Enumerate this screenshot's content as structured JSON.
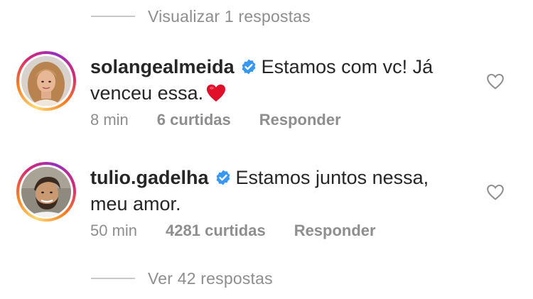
{
  "replies_top": {
    "label": "Visualizar 1 respostas"
  },
  "comments": [
    {
      "username": "solangealmeida",
      "verified": true,
      "text_line1": "Estamos com vc! Já",
      "text_line2": "venceu essa.",
      "emoji": "red-heart-emoji",
      "time": "8 min",
      "likes": "6 curtidas",
      "reply_label": "Responder",
      "like_icon": "heart-outline-icon"
    },
    {
      "username": "tulio.gadelha",
      "verified": true,
      "text_line1": "Estamos juntos nessa,",
      "text_line2": "meu amor.",
      "time": "50 min",
      "likes": "4281 curtidas",
      "reply_label": "Responder",
      "like_icon": "heart-outline-icon"
    }
  ],
  "replies_bottom": {
    "label": "Ver 42 respostas"
  },
  "colors": {
    "text": "#262626",
    "secondary": "#8e8e8e",
    "verified_blue": "#3897f0",
    "emoji_red": "#e0102a"
  }
}
